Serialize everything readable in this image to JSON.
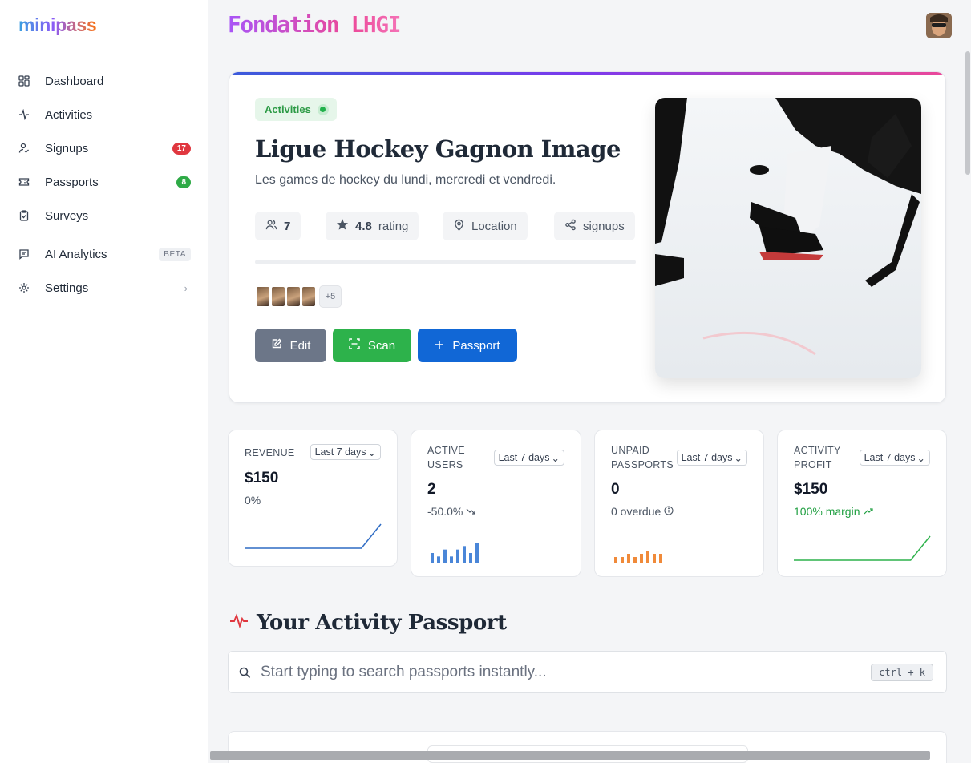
{
  "brand": {
    "logo": "minipass"
  },
  "sidebar": {
    "items": [
      {
        "label": "Dashboard",
        "icon": "dashboard-icon"
      },
      {
        "label": "Activities",
        "icon": "activity-pulse-icon"
      },
      {
        "label": "Signups",
        "icon": "user-check-icon",
        "badge": "17"
      },
      {
        "label": "Passports",
        "icon": "ticket-icon",
        "badge": "8"
      },
      {
        "label": "Surveys",
        "icon": "clipboard-check-icon"
      },
      {
        "label": "AI Analytics",
        "icon": "message-square-icon",
        "badge": "BETA"
      },
      {
        "label": "Settings",
        "icon": "settings-gear-icon"
      }
    ]
  },
  "header": {
    "org_title": "Fondation LHGI"
  },
  "hero": {
    "tag": "Activities",
    "title": "Ligue Hockey Gagnon Image",
    "subtitle": "Les games de hockey du lundi, mercredi et vendredi.",
    "stats": {
      "users": "7",
      "rating_value": "4.8",
      "rating_label": "rating",
      "location": "Location",
      "signups": "signups"
    },
    "progress_fraction": 0,
    "avatars_more": "+5",
    "buttons": {
      "edit": "Edit",
      "scan": "Scan",
      "passport": "Passport"
    }
  },
  "metrics": [
    {
      "label": "REVENUE",
      "period": "Last 7 days",
      "value": "$150",
      "sub": "0%",
      "trend": [
        0,
        0,
        0,
        0,
        0,
        0,
        0,
        1
      ]
    },
    {
      "label": "ACTIVE USERS",
      "period": "Last 7 days",
      "value": "2",
      "sub": "-50.0%",
      "bars": [
        3,
        2,
        4,
        2,
        4,
        5,
        3,
        6
      ]
    },
    {
      "label": "UNPAID PASSPORTS",
      "period": "Last 7 days",
      "value": "0",
      "sub": "0 overdue",
      "bars": [
        2,
        2,
        3,
        2,
        3,
        4,
        3,
        3
      ]
    },
    {
      "label": "ACTIVITY PROFIT",
      "period": "Last 7 days",
      "value": "$150",
      "sub": "100% margin",
      "trend": [
        0,
        0,
        0,
        0,
        0,
        0,
        0,
        1
      ]
    }
  ],
  "colors": {
    "accent_blue": "#1167d6",
    "success_green": "#2db24b",
    "danger_red": "#e0373f",
    "slate": "#6c7688",
    "bar_blue": "#4a86d8",
    "bar_orange": "#f08a3a"
  },
  "passport_section": {
    "title": "Your Activity Passport",
    "search_placeholder": "Start typing to search passports instantly...",
    "shortcut": "ctrl + k"
  }
}
